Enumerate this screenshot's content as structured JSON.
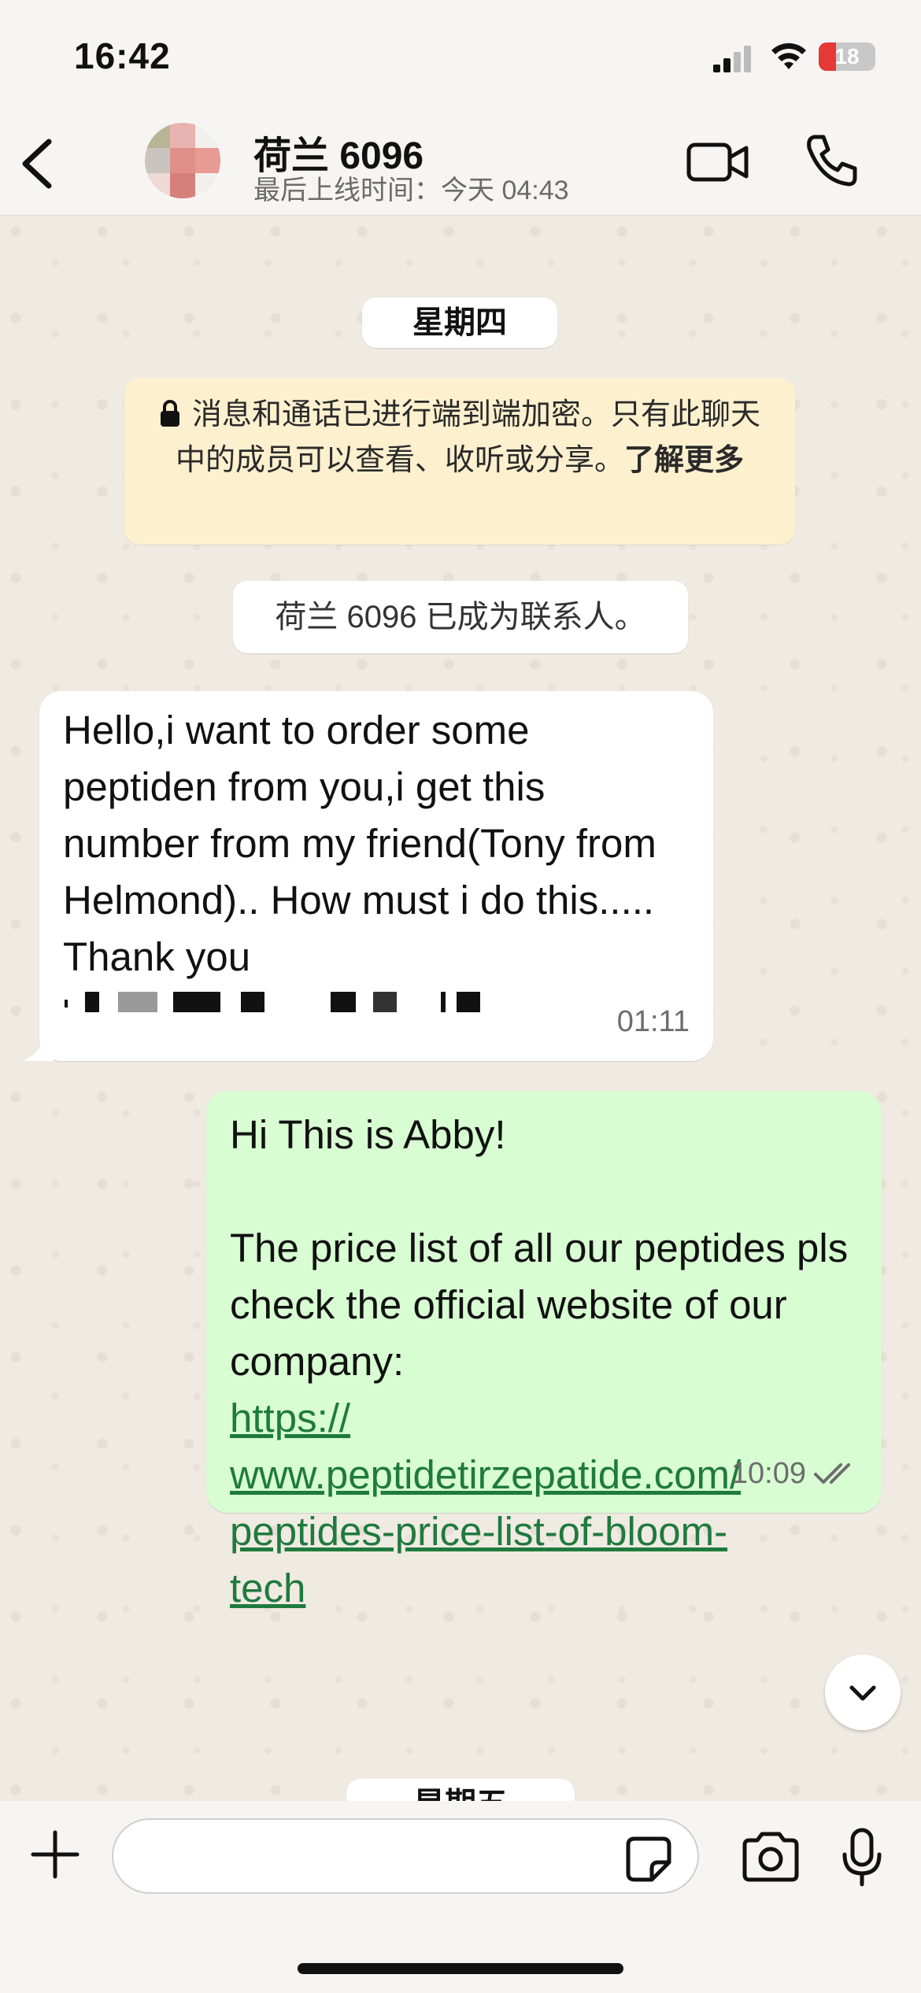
{
  "status_bar": {
    "time": "16:42",
    "battery_level": "18",
    "icons": [
      "signal-icon",
      "wifi-icon",
      "battery-icon"
    ]
  },
  "header": {
    "contact_name": "荷兰 6096",
    "last_seen": "最后上线时间：今天 04:43",
    "icons": [
      "back-icon",
      "video-call-icon",
      "phone-call-icon"
    ]
  },
  "chat": {
    "day_label": "星期四",
    "encryption": {
      "text": "消息和通话已进行端到端加密。只有此聊天中的成员可以查看、收听或分享。",
      "learn_more": "了解更多"
    },
    "contact_added": "荷兰 6096 已成为联系人。",
    "messages": [
      {
        "direction": "incoming",
        "text": "Hello,i want to order some peptiden from you,i get this number from my friend(Tony from Helmond).. How must i do this..... Thank you",
        "time": "01:11"
      },
      {
        "direction": "outgoing",
        "text": "Hi This is Abby!\n\nThe price list of all our peptides pls check the official website of our company:\n",
        "link": "https://\nwww.peptidetirzepatide.com/\npeptides-price-list-of-bloom-\ntech",
        "time": "10:09",
        "status": "read"
      }
    ],
    "next_day_label": "星期五"
  },
  "input_bar": {
    "placeholder": "",
    "icons": [
      "plus-icon",
      "sticker-icon",
      "camera-icon",
      "microphone-icon"
    ]
  },
  "colors": {
    "chat_background": "#efeae2",
    "outgoing_bubble": "#d8fdd2",
    "incoming_bubble": "#ffffff",
    "encryption_notice": "#fdf0cf",
    "link": "#1f7a3d",
    "read_receipt": "#6d6d6d"
  }
}
